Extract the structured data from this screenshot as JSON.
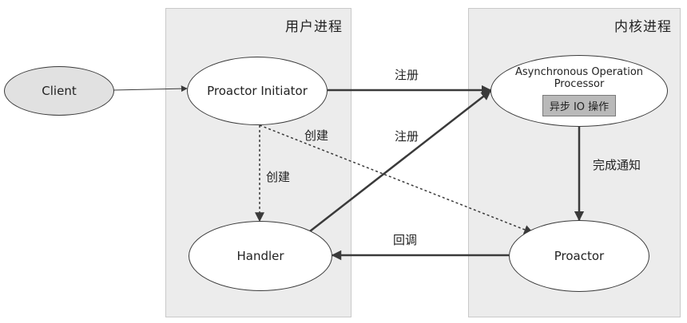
{
  "regions": {
    "user_process": "用户进程",
    "kernel_process": "内核进程"
  },
  "nodes": {
    "client": "Client",
    "proactor_initiator": "Proactor Initiator",
    "async_processor": "Asynchronous Operation Processor",
    "async_io": "异步 IO 操作",
    "handler": "Handler",
    "proactor": "Proactor"
  },
  "edges": {
    "register_1": "注册",
    "register_2": "注册",
    "create_handler": "创建",
    "create_proactor": "创建",
    "notify_complete": "完成通知",
    "callback": "回调"
  },
  "colors": {
    "region_bg": "#ececec",
    "line": "#3a3a3a"
  }
}
